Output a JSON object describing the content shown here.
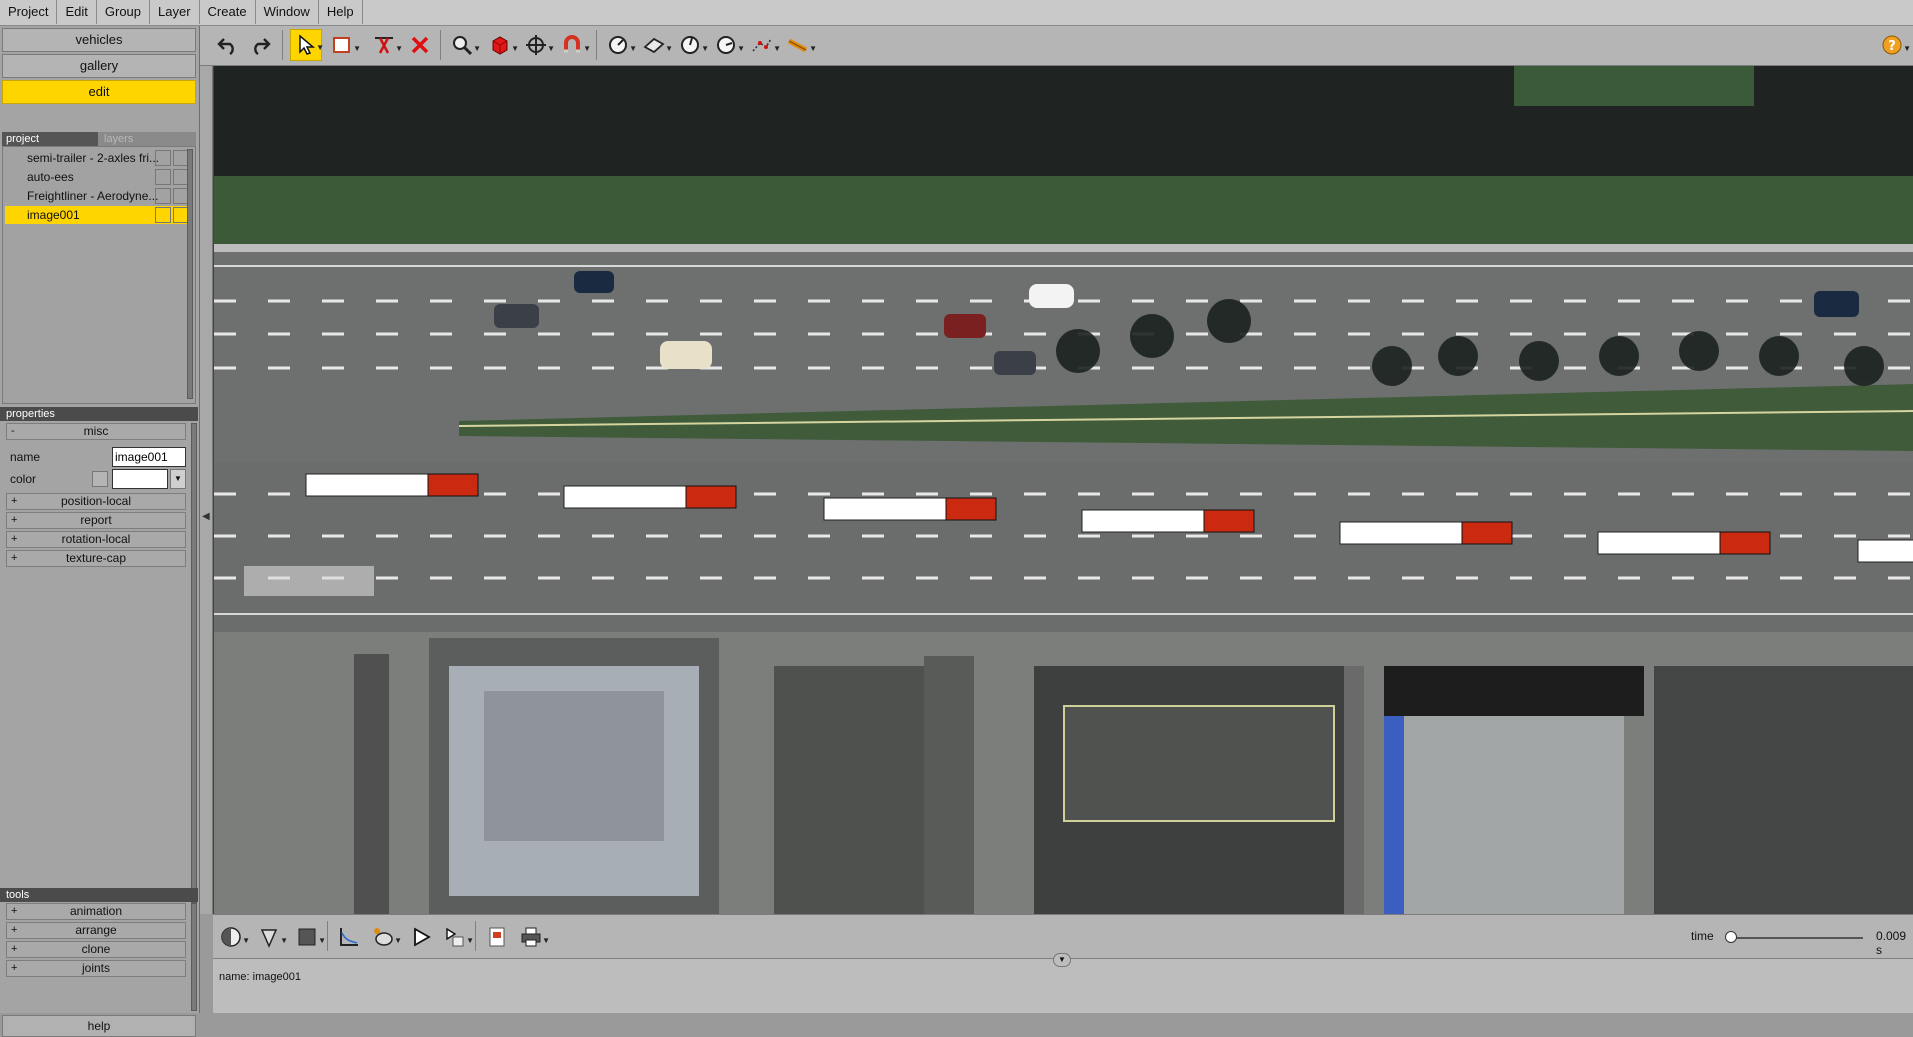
{
  "menu": [
    "Project",
    "Edit",
    "Group",
    "Layer",
    "Create",
    "Window",
    "Help"
  ],
  "nav": {
    "vehicles": "vehicles",
    "gallery": "gallery",
    "edit": "edit"
  },
  "project_tabs": {
    "project": "project",
    "layers": "layers"
  },
  "layers": [
    {
      "label": "semi-trailer - 2-axles fri...",
      "selected": false
    },
    {
      "label": "auto-ees",
      "selected": false
    },
    {
      "label": "Freightliner - Aerodyne...",
      "selected": false
    },
    {
      "label": "image001",
      "selected": true
    }
  ],
  "properties": {
    "header": "properties",
    "misc": "misc",
    "name_label": "name",
    "name_value": "image001",
    "color_label": "color",
    "groups": [
      "position-local",
      "report",
      "rotation-local",
      "texture-cap"
    ]
  },
  "tools": {
    "header": "tools",
    "items": [
      "animation",
      "arrange",
      "clone",
      "joints"
    ]
  },
  "help": "help",
  "toolbar_icons": [
    "undo-icon",
    "redo-icon",
    "select-arrow-icon",
    "rectangle-select-icon",
    "cut-edge-icon",
    "delete-icon",
    "zoom-icon",
    "solid-box-icon",
    "move-crosshair-icon",
    "magnet-icon",
    "measure-dial-icon",
    "plane-icon",
    "angle-dial-icon",
    "rotate-dial-icon",
    "path-icon",
    "ruler-icon",
    "help-icon"
  ],
  "time": {
    "label": "time",
    "value": "0.009 s",
    "position": 0.0
  },
  "status": {
    "text": "name: image001"
  },
  "colors": {
    "accent": "#ffd500",
    "panel": "#a4a4a4",
    "toolbar": "#b5b5b5"
  }
}
